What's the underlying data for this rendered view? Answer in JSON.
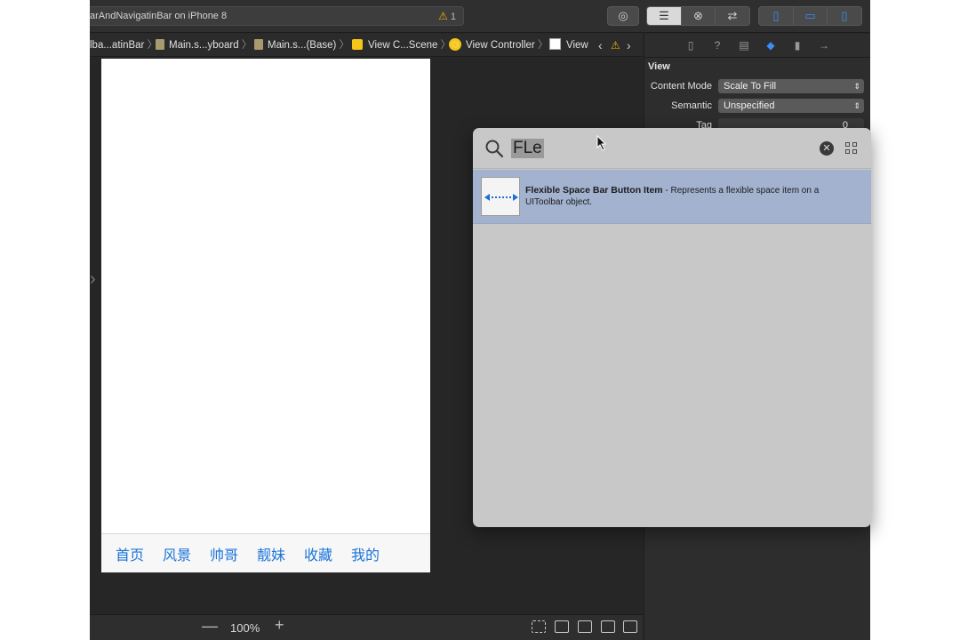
{
  "toolbar": {
    "scheme_text": "arAndNavigatinBar on iPhone 8",
    "warning_count": "1"
  },
  "breadcrumb": {
    "items": [
      "lba...atinBar",
      "Main.s...yboard",
      "Main.s...(Base)",
      "View C...Scene",
      "View Controller",
      "View"
    ]
  },
  "canvas": {
    "tabs": [
      "首页",
      "风景",
      "帅哥",
      "靓妹",
      "收藏",
      "我的"
    ],
    "zoom": "100%"
  },
  "inspector": {
    "section_title": "View",
    "properties": [
      {
        "label": "Content Mode",
        "value": "Scale To Fill"
      },
      {
        "label": "Semantic",
        "value": "Unspecified"
      },
      {
        "label": "Tag",
        "value": "0"
      }
    ]
  },
  "library": {
    "query": "FLe",
    "results": [
      {
        "title": "Flexible Space Bar Button Item",
        "description": " - Represents a flexible space item on a UIToolbar object."
      }
    ]
  },
  "colors": {
    "accent": "#3a8ef6",
    "tab_text": "#1a73d8",
    "selection": "#a3b2cf",
    "warning": "#f0b30a"
  }
}
